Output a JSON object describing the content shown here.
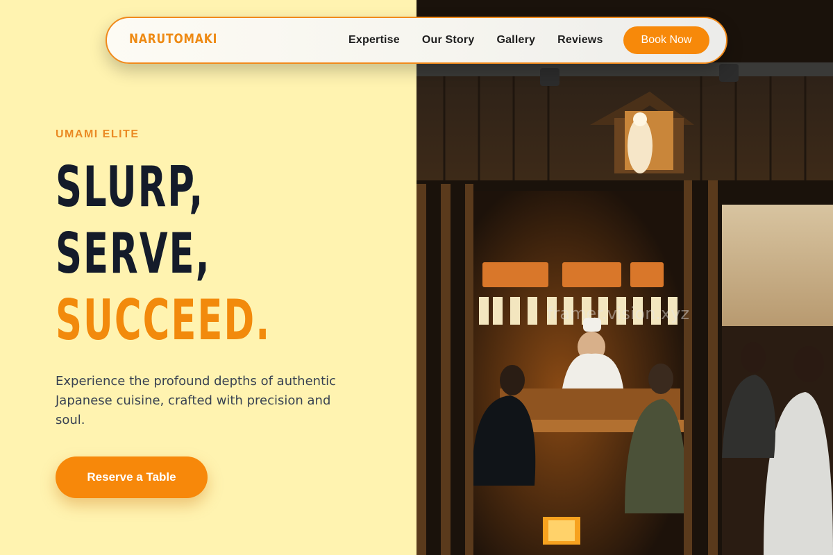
{
  "nav": {
    "brand": "NARUTOMAKI",
    "links": [
      "Expertise",
      "Our Story",
      "Gallery",
      "Reviews"
    ],
    "cta": "Book Now"
  },
  "hero": {
    "eyebrow": "UMAMI ELITE",
    "headline": [
      "SLURP,",
      "SERVE,",
      "SUCCEED."
    ],
    "description": "Experience the profound depths of authentic Japanese cuisine, crafted with precision and soul.",
    "cta": "Reserve a Table"
  },
  "image": {
    "subject": "restaurant-interior-photo",
    "watermark": "framer.vision.xyz"
  },
  "colors": {
    "accent": "#f7890a",
    "background": "#fff3b0",
    "headline_dark": "#141b2a"
  }
}
